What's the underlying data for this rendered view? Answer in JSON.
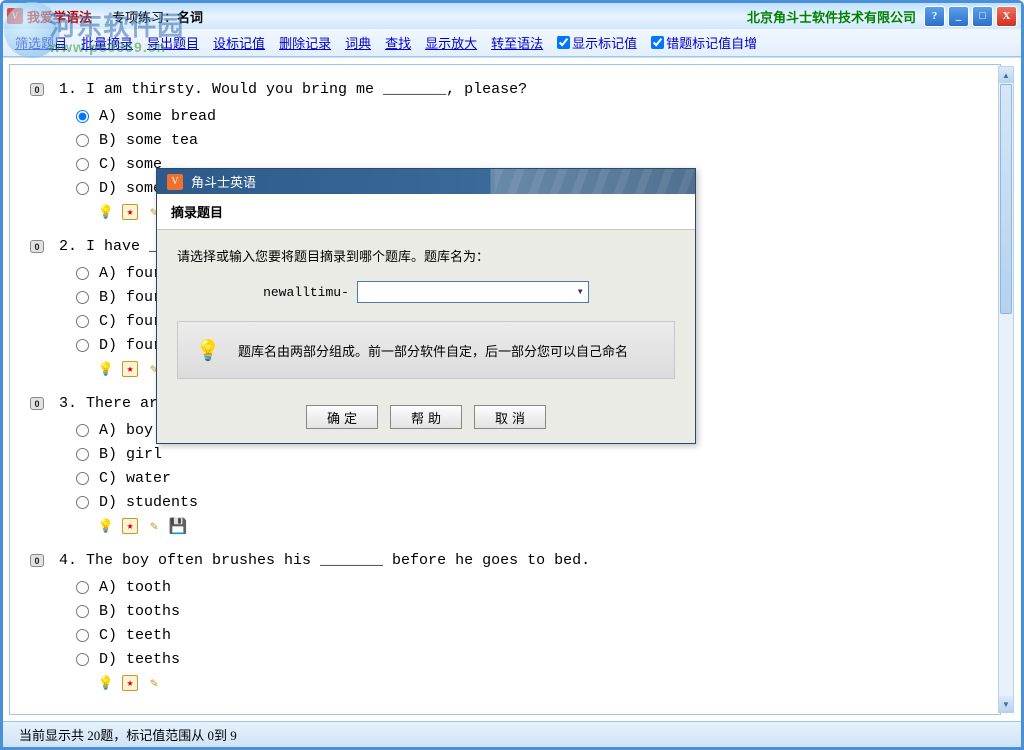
{
  "watermark": {
    "cn": "河东软件园",
    "url": "www.pc0359.cn"
  },
  "titlebar": {
    "app_title": "我爱学语法",
    "subtitle_label": "专项练习：",
    "subtitle_value": "名词",
    "company": "北京角斗士软件技术有限公司"
  },
  "win_buttons": {
    "help": "?",
    "min": "_",
    "max": "□",
    "close": "X"
  },
  "toolbar": {
    "links": [
      "筛选题目",
      "批量摘录",
      "导出题目",
      "设标记值",
      "删除记录",
      "词典",
      "查找",
      "显示放大",
      "转至语法"
    ],
    "chk1_label": "显示标记值",
    "chk2_label": "错题标记值自增"
  },
  "questions": [
    {
      "num": "1.",
      "text": "I am thirsty. Would you bring me _______, please?",
      "options": [
        "A) some bread",
        "B) some tea",
        "C) some",
        "D) some"
      ],
      "selected": 0,
      "show_save": false
    },
    {
      "num": "2.",
      "text": "I have _",
      "options": [
        "A) four",
        "B) four",
        "C) four",
        "D) four"
      ],
      "selected": -1,
      "show_save": false
    },
    {
      "num": "3.",
      "text": "There ar",
      "options": [
        "A) boy",
        "B) girl",
        "C) water",
        "D) students"
      ],
      "selected": -1,
      "show_save": true
    },
    {
      "num": "4.",
      "text": "The boy often brushes his _______ before he goes to bed.",
      "options": [
        "A) tooth",
        "B) tooths",
        "C) teeth",
        "D) teeths"
      ],
      "selected": -1,
      "show_save": false
    }
  ],
  "statusbar": {
    "text": "当前显示共 20题，标记值范围从 0到 9"
  },
  "modal": {
    "title": "角斗士英语",
    "header": "摘录题目",
    "prompt": "请选择或输入您要将题目摘录到哪个题库。题库名为：",
    "combo_label": "newalltimu-",
    "info": "题库名由两部分组成。前一部分软件自定，后一部分您可以自己命名",
    "btn_ok": "确定",
    "btn_help": "帮助",
    "btn_cancel": "取消"
  }
}
